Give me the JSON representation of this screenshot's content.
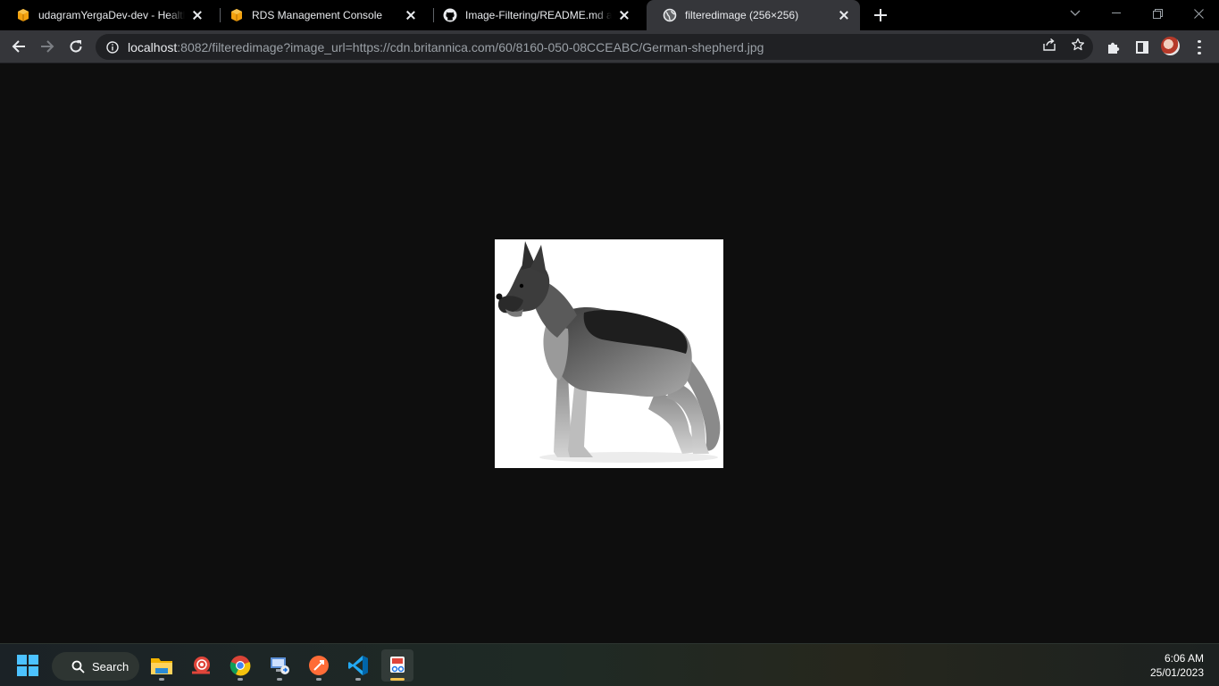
{
  "browser": {
    "tabs": [
      {
        "title": "udagramYergaDev-dev - Health D",
        "icon": "aws-box-icon",
        "active": false
      },
      {
        "title": "RDS Management Console",
        "icon": "aws-box-icon",
        "active": false
      },
      {
        "title": "Image-Filtering/README.md at m",
        "icon": "github-icon",
        "active": false
      },
      {
        "title": "filteredimage (256×256)",
        "icon": "globe-icon",
        "active": true
      }
    ],
    "url_host": "localhost",
    "url_rest": ":8082/filteredimage?image_url=https://cdn.britannica.com/60/8160-050-08CCEABC/German-shepherd.jpg"
  },
  "content": {
    "image_subject": "german-shepherd-dog"
  },
  "taskbar": {
    "search_label": "Search",
    "apps": [
      "file-explorer",
      "snail-app",
      "chrome",
      "remote-desktop",
      "postman",
      "vscode",
      "snipping-tool"
    ],
    "time": "6:06 AM",
    "date": "25/01/2023"
  },
  "colors": {
    "tabstrip_bg": "#000000",
    "toolbar_bg": "#35363a",
    "omnibox_bg": "#202124",
    "page_bg": "#0e0e0e",
    "aws_orange": "#f2a10f"
  }
}
